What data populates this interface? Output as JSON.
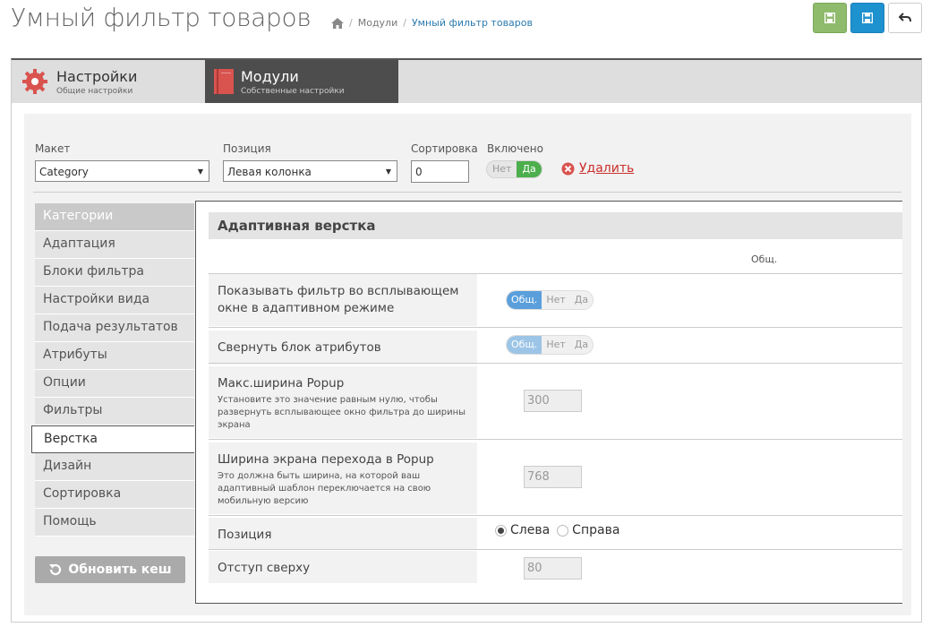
{
  "header": {
    "title": "Умный фильтр товаров",
    "breadcrumbs": [
      "Модули",
      "Умный фильтр товаров"
    ]
  },
  "tabs": [
    {
      "title": "Настройки",
      "subtitle": "Общие настройки",
      "icon": "gear-icon"
    },
    {
      "title": "Модули",
      "subtitle": "Собственные настройки",
      "icon": "book-icon"
    }
  ],
  "filters": {
    "layout_label": "Макет",
    "layout_value": "Category",
    "position_label": "Позиция",
    "position_value": "Левая колонка",
    "sort_label": "Сортировка",
    "sort_value": "0",
    "enabled_label": "Включено",
    "enabled_off": "Нет",
    "enabled_on": "Да",
    "delete_label": "Удалить"
  },
  "sidebar": {
    "items": [
      "Категории",
      "Адаптация",
      "Блоки фильтра",
      "Настройки вида",
      "Подача результатов",
      "Атрибуты",
      "Опции",
      "Фильтры",
      "Верстка",
      "Дизайн",
      "Сортировка",
      "Помощь"
    ],
    "refresh_label": "Обновить кеш"
  },
  "section": {
    "title": "Адаптивная верстка",
    "col_header": "Общ.",
    "rows": [
      {
        "label": "Показывать фильтр во всплывающем окне в адаптивном режиме",
        "opts": [
          "Общ.",
          "Нет",
          "Да"
        ]
      },
      {
        "label": "Свернуть блок атрибутов",
        "opts": [
          "Общ.",
          "Нет",
          "Да"
        ]
      },
      {
        "label": "Макс.ширина Popup",
        "help": "Установите это значение равным нулю, чтобы развернуть всплывающее окно фильтра до ширины экрана",
        "value": "300"
      },
      {
        "label": "Ширина экрана перехода в Popup",
        "help": "Это должна быть ширина, на которой ваш адаптивный шаблон переключается на свою мобильную версию",
        "value": "768"
      },
      {
        "label": "Позиция",
        "radio_left": "Слева",
        "radio_right": "Справа"
      },
      {
        "label": "Отступ сверху",
        "value": "80"
      }
    ]
  }
}
